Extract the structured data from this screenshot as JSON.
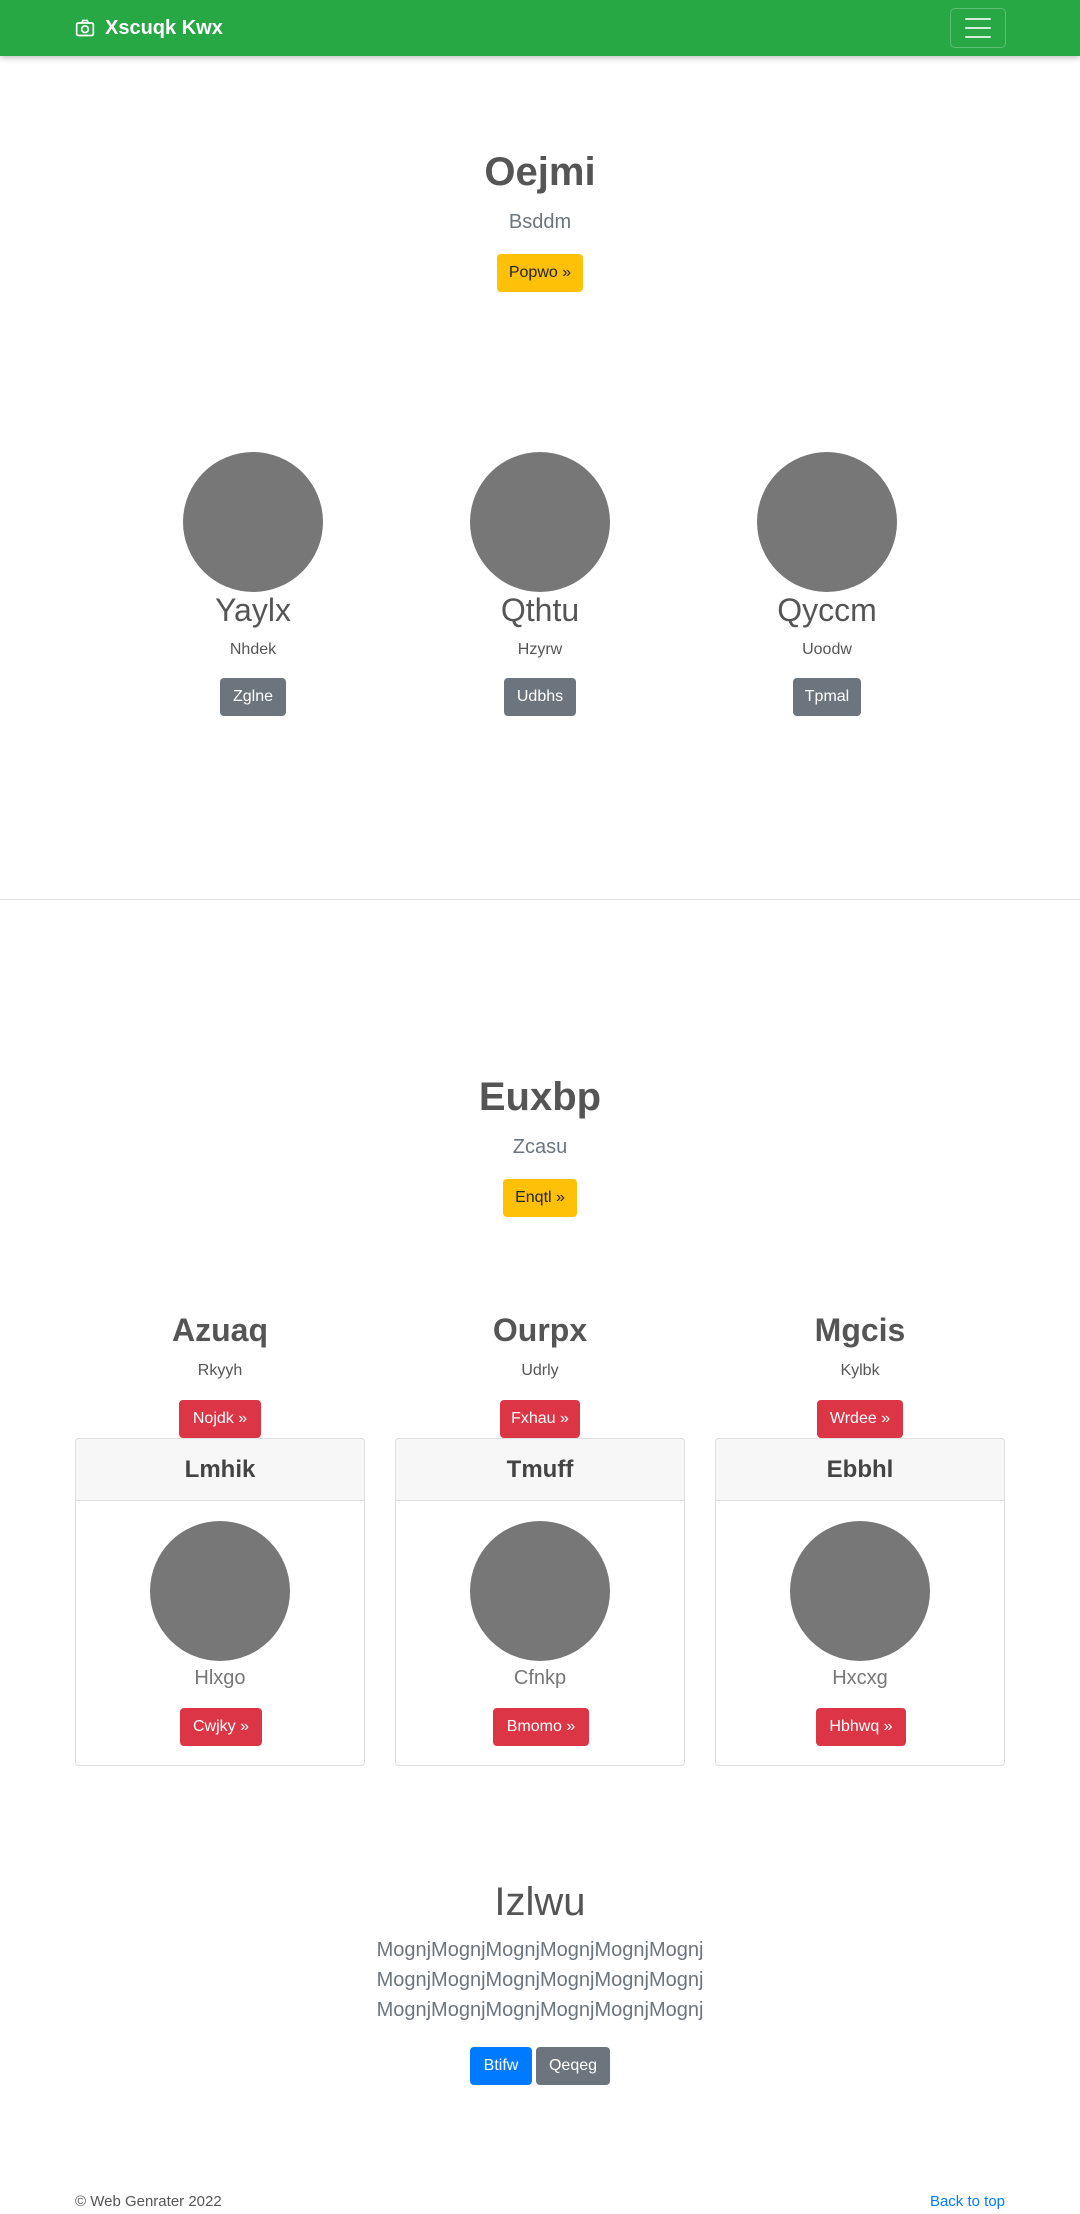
{
  "navbar": {
    "brand": "Xscuqk Kwx",
    "brand_icon": "camera-icon",
    "toggler_icon": "hamburger-icon"
  },
  "hero1": {
    "title": "Oejmi",
    "subtitle": "Bsddm",
    "button": "Popwo »"
  },
  "features": [
    {
      "name": "Yaylx",
      "sub": "Nhdek",
      "button": "Zglne"
    },
    {
      "name": "Qthtu",
      "sub": "Hzyrw",
      "button": "Udbhs"
    },
    {
      "name": "Qyccm",
      "sub": "Uoodw",
      "button": "Tpmal"
    }
  ],
  "hero2": {
    "title": "Euxbp",
    "subtitle": "Zcasu",
    "button": "Enqtl »"
  },
  "columns": [
    {
      "title": "Azuaq",
      "sub": "Rkyyh",
      "button": "Nojdk »"
    },
    {
      "title": "Ourpx",
      "sub": "Udrly",
      "button": "Fxhau »"
    },
    {
      "title": "Mgcis",
      "sub": "Kylbk",
      "button": "Wrdee »"
    }
  ],
  "cards": [
    {
      "header": "Lmhik",
      "text": "Hlxgo",
      "button": "Cwjky »"
    },
    {
      "header": "Tmuff",
      "text": "Cfnkp",
      "button": "Bmomo »"
    },
    {
      "header": "Ebbhl",
      "text": "Hxcxg",
      "button": "Hbhwq »"
    }
  ],
  "about": {
    "title": "Izlwu",
    "lines": [
      "MognjMognjMognjMognjMognjMognj",
      "MognjMognjMognjMognjMognjMognj",
      "MognjMognjMognjMognjMognjMognj"
    ],
    "primary_button": "Btifw",
    "secondary_button": "Qeqeg"
  },
  "footer": {
    "copyright": "© Web Genrater 2022",
    "back_to_top": "Back to top"
  },
  "colors": {
    "navbar": "#28a745",
    "warning": "#ffc107",
    "danger": "#dc3545",
    "secondary": "#6c757d",
    "primary": "#007bff",
    "placeholder": "#777777"
  }
}
